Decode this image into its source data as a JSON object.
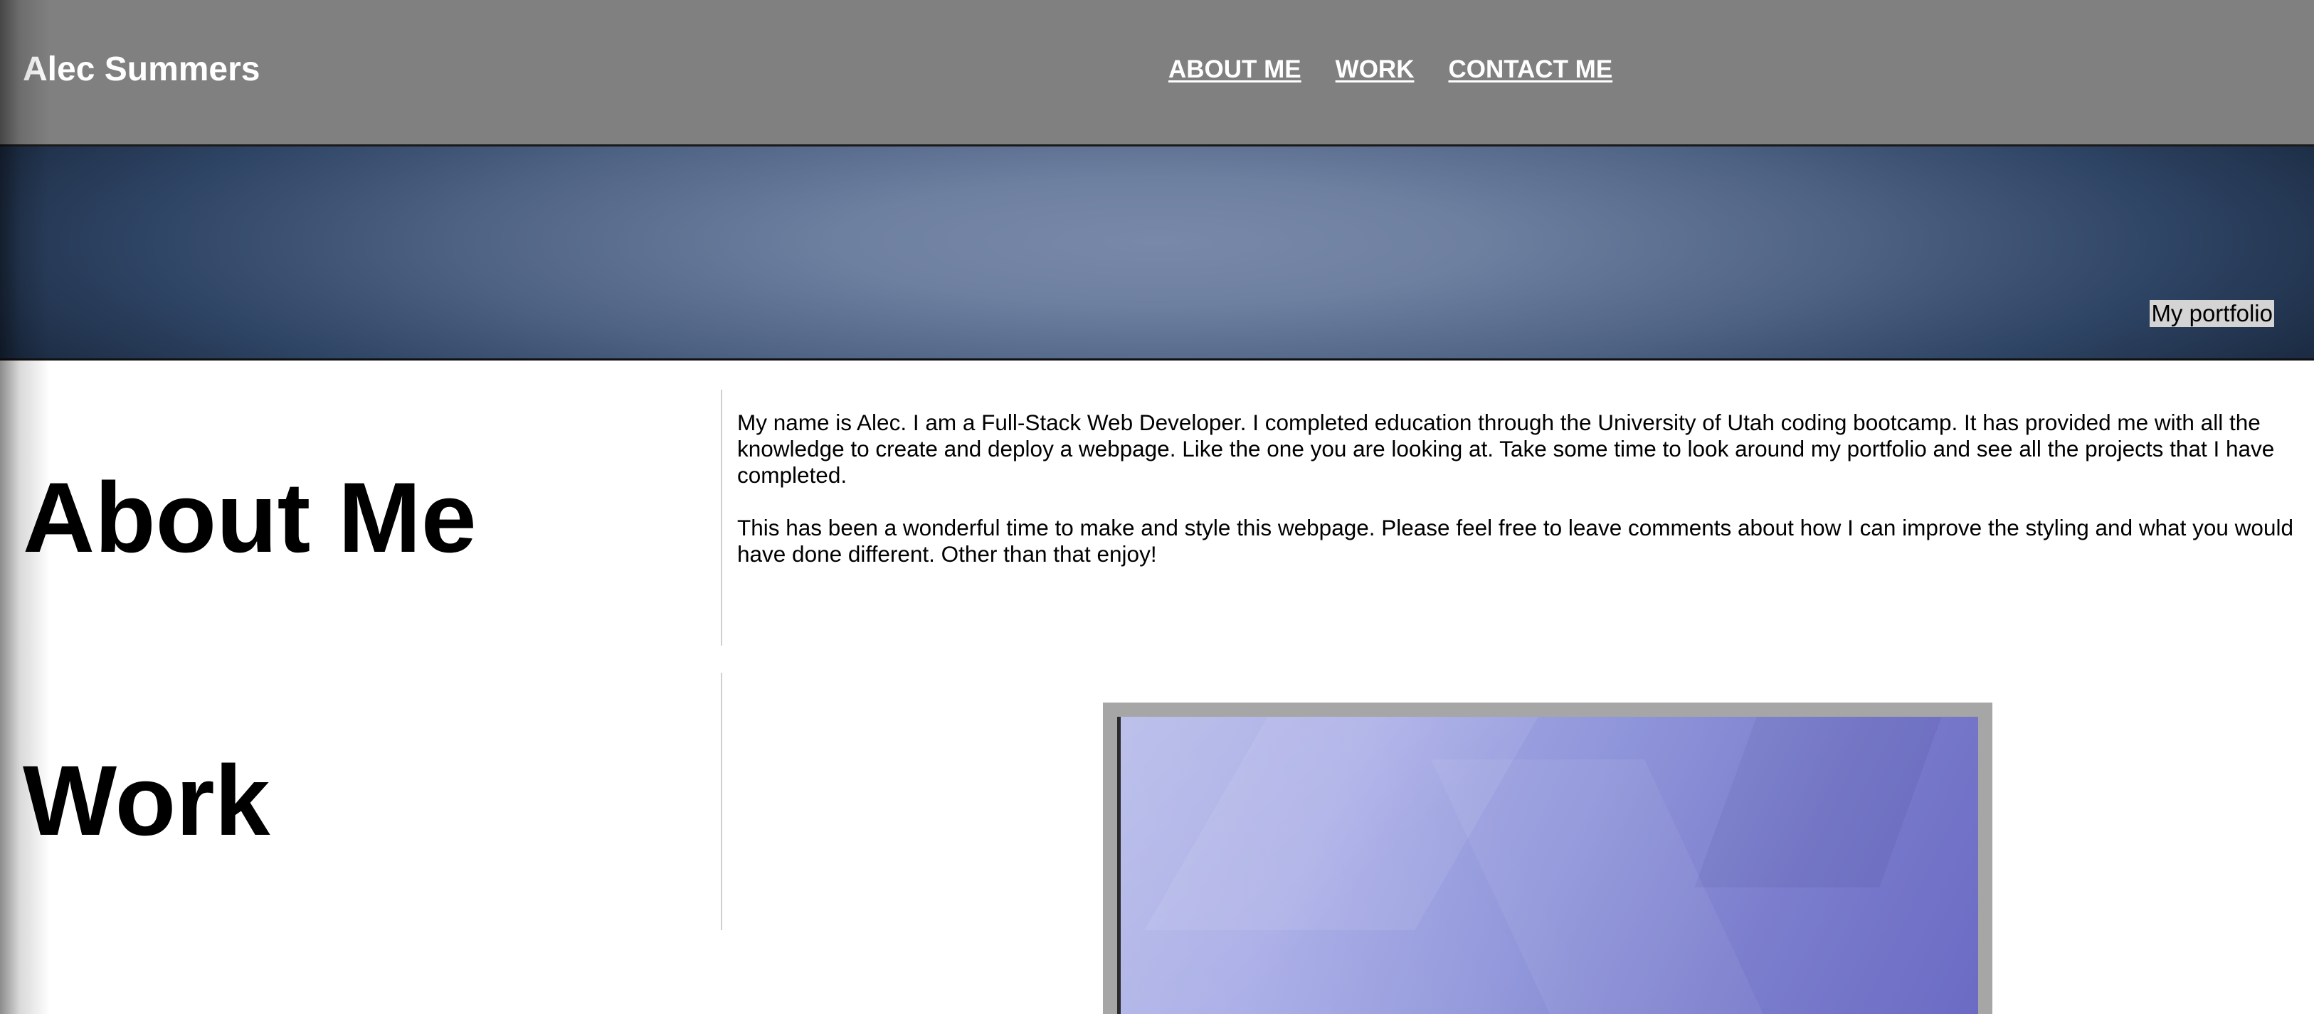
{
  "header": {
    "site_title": "Alec Summers",
    "nav": [
      {
        "label": "ABOUT ME"
      },
      {
        "label": "WORK"
      },
      {
        "label": "CONTACT ME"
      }
    ]
  },
  "hero": {
    "badge": "My portfolio"
  },
  "about": {
    "heading": "About Me",
    "paragraphs": [
      "My name is Alec. I am a Full-Stack Web Developer. I completed education through the University of Utah coding bootcamp. It has provided me with all the knowledge to create and deploy a webpage. Like the one you are looking at. Take some time to look around my portfolio and see all the projects that I have completed.",
      "This has been a wonderful time to make and style this webpage. Please feel free to leave comments about how I can improve the styling and what you would have done different. Other than that enjoy!"
    ]
  },
  "work": {
    "heading": "Work"
  },
  "colors": {
    "header_bg": "#808080",
    "hero_center": "#7888a8",
    "hero_edge": "#1c2c44",
    "project_frame": "#a6a6a6",
    "project_image": "#9096da"
  }
}
